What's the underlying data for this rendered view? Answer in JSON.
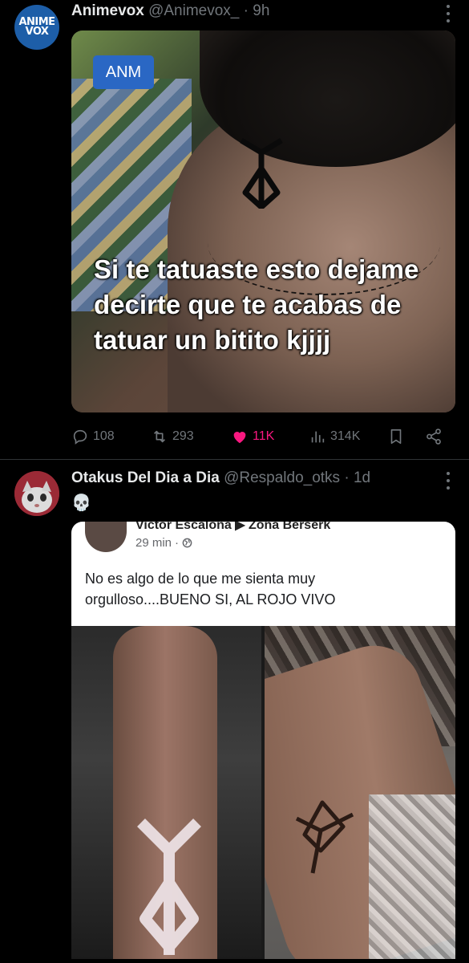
{
  "tweets": [
    {
      "author": {
        "name": "Animevox",
        "handle": "@Animevox_",
        "avatar_text": [
          "ANIME",
          "VOX"
        ]
      },
      "separator": "·",
      "time": "9h",
      "media": {
        "badge": "ANM",
        "caption": "Si te tatuaste esto dejame decirte que te acabas de tatuar un bitito kjjjj"
      },
      "stats": {
        "replies": "108",
        "retweets": "293",
        "likes": "11K",
        "views": "314K"
      },
      "liked": true
    },
    {
      "author": {
        "name": "Otakus Del Dia a Dia",
        "handle": "@Respaldo_otks"
      },
      "separator": "·",
      "time": "1d",
      "text": "💀",
      "embedded_post": {
        "author_line": "Victor Escalona ▶ Zona Berserk",
        "time": "29 min",
        "dot": "·",
        "text": "No es algo de lo que me sienta muy orgulloso....BUENO SI, AL ROJO VIVO"
      }
    }
  ],
  "colors": {
    "background": "#000000",
    "text": "#e7e9ea",
    "muted": "#71767b",
    "like": "#f91880",
    "badge": "#2a67c4"
  },
  "icons": [
    "more-icon",
    "reply-icon",
    "retweet-icon",
    "heart-icon",
    "views-icon",
    "bookmark-icon",
    "share-icon",
    "globe-icon"
  ]
}
